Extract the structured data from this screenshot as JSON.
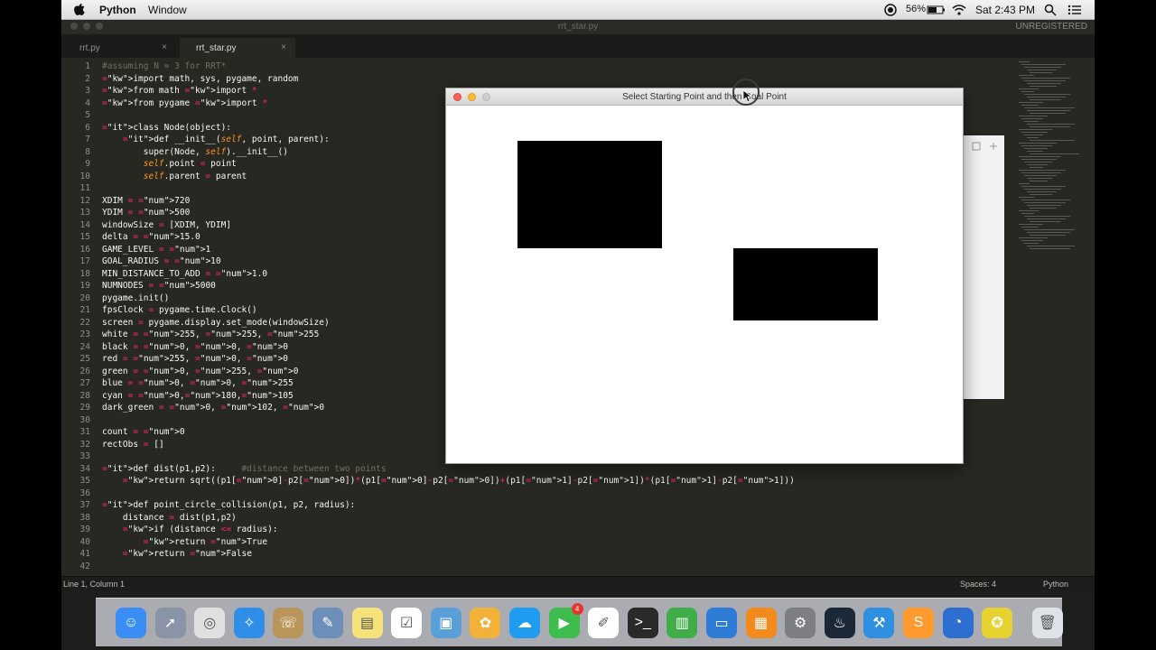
{
  "menubar": {
    "app_name": "Python",
    "window_menu": "Window",
    "battery": "56%",
    "clock": "Sat 2:43 PM"
  },
  "editor": {
    "window_title": "rrt_star.py",
    "license_status": "UNREGISTERED",
    "tabs": [
      {
        "label": "rrt.py"
      },
      {
        "label": "rrt_star.py"
      }
    ],
    "lines": [
      "#assuming N = 3 for RRT*",
      "import math, sys, pygame, random",
      "from math import *",
      "from pygame import *",
      "",
      "class Node(object):",
      "    def __init__(self, point, parent):",
      "        super(Node, self).__init__()",
      "        self.point = point",
      "        self.parent = parent",
      "",
      "XDIM = 720",
      "YDIM = 500",
      "windowSize = [XDIM, YDIM]",
      "delta = 15.0",
      "GAME_LEVEL = 1",
      "GOAL_RADIUS = 10",
      "MIN_DISTANCE_TO_ADD = 1.0",
      "NUMNODES = 5000",
      "pygame.init()",
      "fpsClock = pygame.time.Clock()",
      "screen = pygame.display.set_mode(windowSize)",
      "white = 255, 255, 255",
      "black = 0, 0, 0",
      "red = 255, 0, 0",
      "green = 0, 255, 0",
      "blue = 0, 0, 255",
      "cyan = 0,180,105",
      "dark_green = 0, 102, 0",
      "",
      "count = 0",
      "rectObs = []",
      "",
      "def dist(p1,p2):     #distance between two points",
      "    return sqrt((p1[0]-p2[0])*(p1[0]-p2[0])+(p1[1]-p2[1])*(p1[1]-p2[1]))",
      "",
      "def point_circle_collision(p1, p2, radius):",
      "    distance = dist(p1,p2)",
      "    if (distance <= radius):",
      "        return True",
      "    return False",
      ""
    ],
    "status": {
      "position": "Line 1, Column 1",
      "indent": "Spaces: 4",
      "syntax": "Python"
    }
  },
  "pygame_window": {
    "title": "Select Starting Point and then Goal Point"
  },
  "dock": {
    "apps": [
      "finder-icon",
      "launchpad-icon",
      "chrome-icon",
      "safari-icon",
      "contacts-icon",
      "preview-icon",
      "notes-icon",
      "reminders-icon",
      "photo-booth-icon",
      "photos-icon",
      "messages-icon",
      "facetime-icon",
      "textedit-icon",
      "terminal-icon",
      "numbers-icon",
      "keynote-icon",
      "ibooks-icon",
      "system-preferences-icon",
      "steam-icon",
      "xcode-icon",
      "sublime-text-icon",
      "quicktime-icon",
      "python-launcher-icon",
      "trash-icon"
    ],
    "facetime_badge": "4"
  }
}
